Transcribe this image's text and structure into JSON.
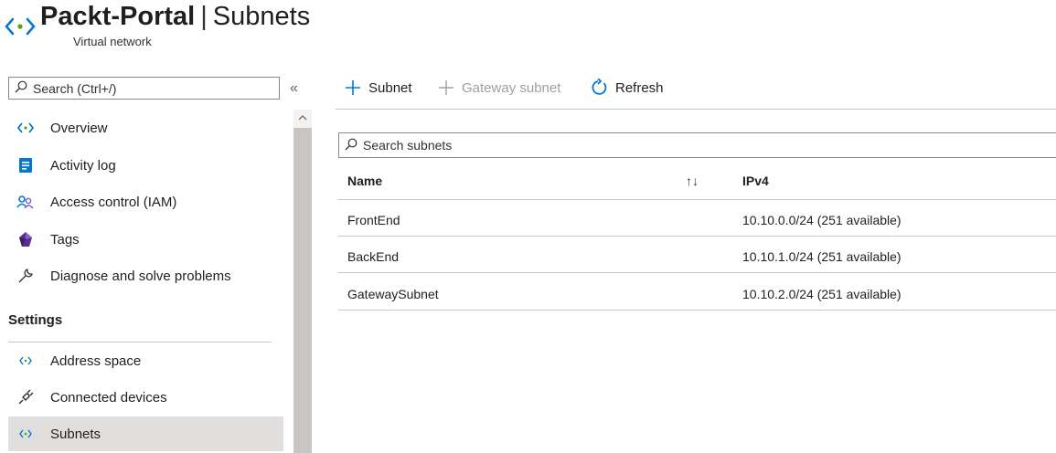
{
  "header": {
    "resource_name": "Packt-Portal",
    "separator": "|",
    "blade_title": "Subnets",
    "resource_type": "Virtual network"
  },
  "sidebar": {
    "search_placeholder": "Search (Ctrl+/)",
    "collapse_glyph": "«",
    "items": [
      {
        "label": "Overview",
        "icon": "vnet-icon"
      },
      {
        "label": "Activity log",
        "icon": "activity-log-icon"
      },
      {
        "label": "Access control (IAM)",
        "icon": "iam-icon"
      },
      {
        "label": "Tags",
        "icon": "tag-icon"
      },
      {
        "label": "Diagnose and solve problems",
        "icon": "wrench-icon"
      }
    ],
    "section": "Settings",
    "settings_items": [
      {
        "label": "Address space",
        "icon": "address-space-icon"
      },
      {
        "label": "Connected devices",
        "icon": "plug-icon"
      },
      {
        "label": "Subnets",
        "icon": "subnet-icon",
        "selected": true
      }
    ]
  },
  "toolbar": {
    "add_subnet": "Subnet",
    "add_gateway_subnet": "Gateway subnet",
    "refresh": "Refresh"
  },
  "subnets": {
    "search_placeholder": "Search subnets",
    "columns": [
      "Name",
      "IPv4"
    ],
    "rows": [
      {
        "name": "FrontEnd",
        "ipv4": "10.10.0.0/24 (251 available)"
      },
      {
        "name": "BackEnd",
        "ipv4": "10.10.1.0/24 (251 available)"
      },
      {
        "name": "GatewaySubnet",
        "ipv4": "10.10.2.0/24 (251 available)"
      }
    ]
  },
  "colors": {
    "accent": "#0078d4",
    "selected_bg": "#e1dfdd",
    "vnet_green": "#57a300"
  }
}
